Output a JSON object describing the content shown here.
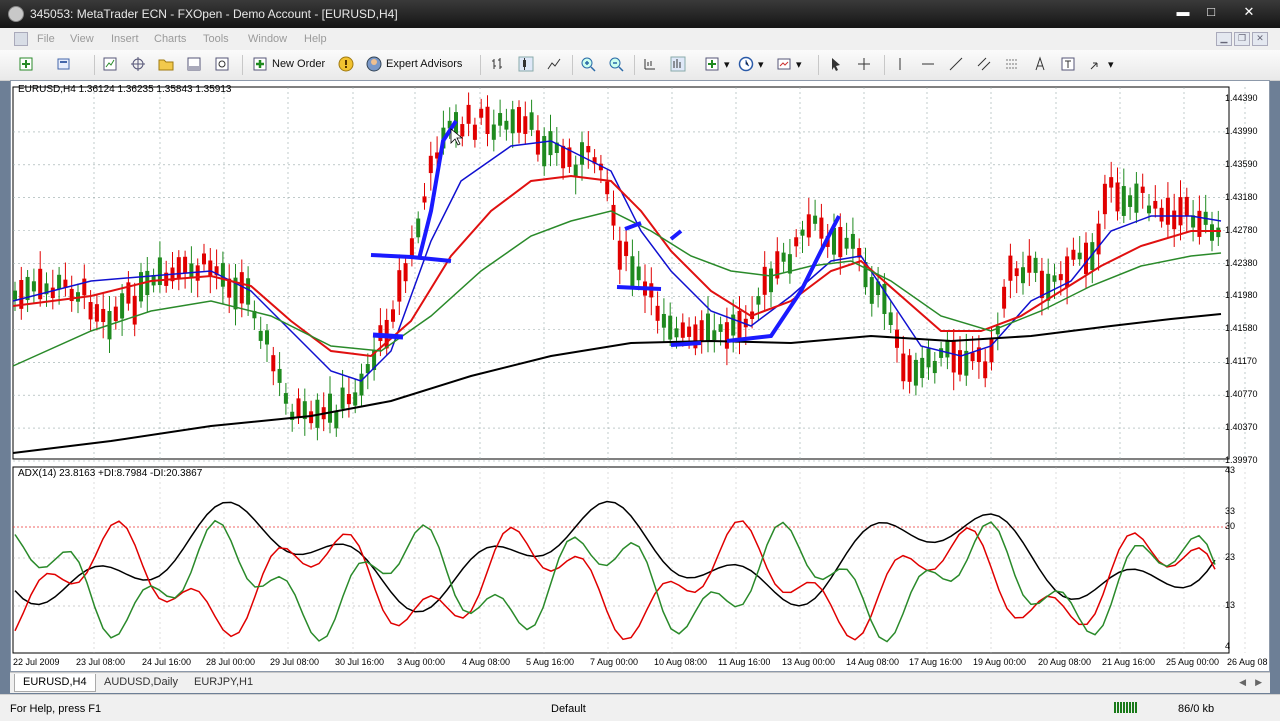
{
  "window": {
    "title": "345053: MetaTrader ECN - FXOpen - Demo Account - [EURUSD,H4]",
    "min": "▬",
    "max": "□",
    "close": "✕"
  },
  "menu": [
    "File",
    "View",
    "Insert",
    "Charts",
    "Tools",
    "Window",
    "Help"
  ],
  "toolbar": {
    "new_order": "New Order",
    "expert_advisors": "Expert Advisors"
  },
  "chart": {
    "info": "EURUSD,H4  1.36124 1.36235 1.35843 1.35913",
    "indicator_info": "ADX(14) 23.8163 +DI:8.7984 -DI:20.3867",
    "price_labels": [
      "1.44390",
      "1.43990",
      "1.43590",
      "1.43180",
      "1.42780",
      "1.42380",
      "1.41980",
      "1.41580",
      "1.41170",
      "1.40770",
      "1.40370",
      "1.39970"
    ],
    "adx_labels": [
      "43",
      "33",
      "30",
      "23",
      "13",
      "4"
    ],
    "date_labels": [
      "22 Jul 2009",
      "23 Jul 08:00",
      "24 Jul 16:00",
      "28 Jul 00:00",
      "29 Jul 08:00",
      "30 Jul 16:00",
      "3 Aug 00:00",
      "4 Aug 08:00",
      "5 Aug 16:00",
      "7 Aug 00:00",
      "10 Aug 08:00",
      "11 Aug 16:00",
      "13 Aug 00:00",
      "14 Aug 08:00",
      "17 Aug 16:00",
      "19 Aug 00:00",
      "20 Aug 08:00",
      "21 Aug 16:00",
      "25 Aug 00:00",
      "26 Aug 08"
    ],
    "colors": {
      "bull": "#1f8a1f",
      "bear": "#e00000",
      "ma_fast": "#1010d0",
      "ma_mid": "#e01010",
      "ma_slow": "#2a8a2a",
      "ma_long": "#000000",
      "drawing": "#1a1aff"
    }
  },
  "tabs": [
    "EURUSD,H4",
    "AUDUSD,Daily",
    "EURJPY,H1"
  ],
  "status": {
    "help": "For Help, press F1",
    "profile": "Default",
    "traffic": "86/0 kb"
  }
}
